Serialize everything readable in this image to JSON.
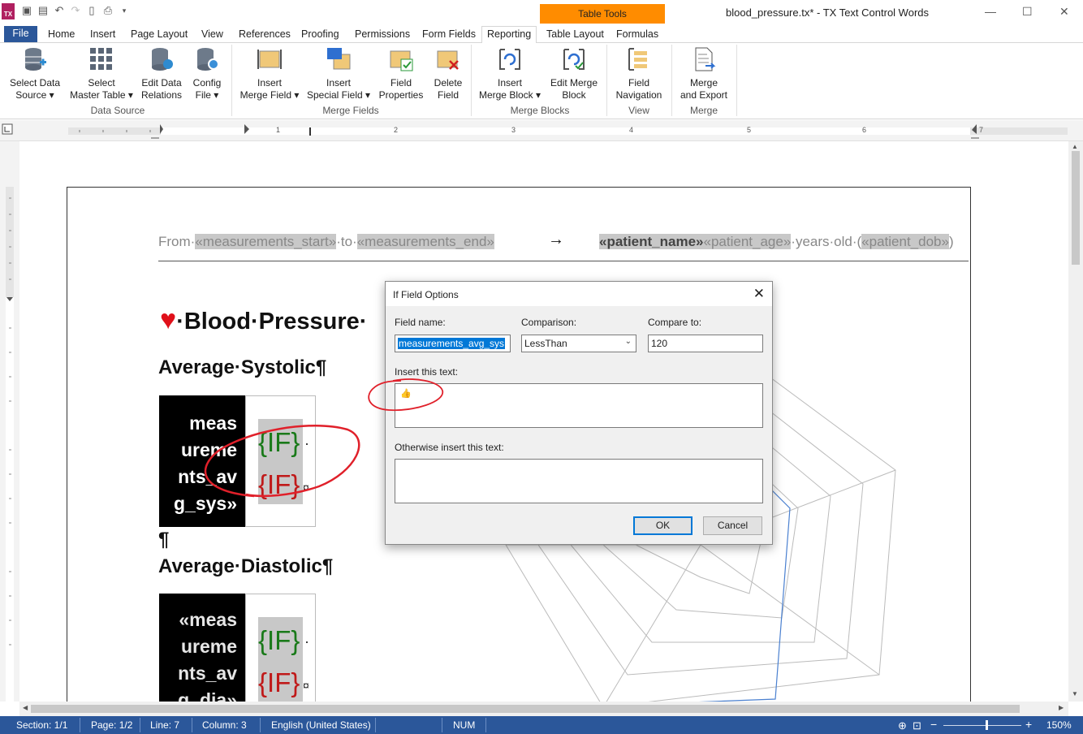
{
  "window": {
    "title": "blood_pressure.tx* - TX Text Control Words",
    "app_icon_label": "TX",
    "contextual_tab": "Table Tools"
  },
  "tabs": [
    "File",
    "Home",
    "Insert",
    "Page Layout",
    "View",
    "References",
    "Proofing",
    "Permissions",
    "Form Fields",
    "Reporting",
    "Table Layout",
    "Formulas"
  ],
  "ribbon": {
    "select_data_source": [
      "Select Data",
      "Source ▾"
    ],
    "select_master_table": [
      "Select",
      "Master Table ▾"
    ],
    "edit_data_relations": [
      "Edit Data",
      "Relations"
    ],
    "config_file": [
      "Config",
      "File ▾"
    ],
    "group_data_source": "Data Source",
    "insert_merge_field": [
      "Insert",
      "Merge Field ▾"
    ],
    "insert_special_field": [
      "Insert",
      "Special Field ▾"
    ],
    "field_properties": [
      "Field",
      "Properties"
    ],
    "delete_field": [
      "Delete",
      "Field"
    ],
    "group_merge_fields": "Merge Fields",
    "insert_merge_block": [
      "Insert",
      "Merge Block ▾"
    ],
    "edit_merge_block": [
      "Edit Merge",
      "Block"
    ],
    "group_merge_blocks": "Merge Blocks",
    "field_navigation": [
      "Field",
      "Navigation"
    ],
    "group_view": "View",
    "merge_and_export": [
      "Merge",
      "and Export"
    ],
    "group_merge": "Merge"
  },
  "ruler": {
    "numbers": [
      "1",
      "2",
      "3",
      "4",
      "5",
      "6",
      "7"
    ]
  },
  "document": {
    "header": {
      "from": "From·",
      "start_field": "«measurements_start»",
      "to": "·to·",
      "end_field": "«measurements_end»",
      "arrow": "→",
      "name_field": "«patient_name»",
      "age_field": "«patient_age»",
      "years_old": "·years·old·(",
      "dob_field": "«patient_dob»",
      "close": ")"
    },
    "title": "·Blood·Pressure·",
    "heart": "♥",
    "systolic_heading": "Average·Systolic¶",
    "systolic_field_lines": [
      "meas",
      "ureme",
      "nts_av",
      "g_sys»"
    ],
    "if_label": "{IF}",
    "dot": "·",
    "cell_end": "¤",
    "pilcrow": "¶",
    "diastolic_heading": "Average·Diastolic¶",
    "diastolic_field_lines": [
      "«meas",
      "ureme",
      "nts_av",
      "g_dia»"
    ]
  },
  "dialog": {
    "title": "If Field Options",
    "close_glyph": "✕",
    "field_name_label": "Field name:",
    "field_name_value": "measurements_avg_sys",
    "comparison_label": "Comparison:",
    "comparison_value": "LessThan",
    "compare_to_label": "Compare to:",
    "compare_to_value": "120",
    "insert_text_label": "Insert this text:",
    "insert_text_value": "👍",
    "otherwise_label": "Otherwise insert this text:",
    "otherwise_value": "",
    "ok": "OK",
    "cancel": "Cancel"
  },
  "status": {
    "section": "Section: 1/1",
    "page": "Page: 1/2",
    "line": "Line: 7",
    "column": "Column: 3",
    "language": "English (United States)",
    "num": "NUM",
    "zoom": "150%"
  },
  "colors": {
    "accent": "#2b579a",
    "contextual": "#ff8c00",
    "annotation": "#e0202a",
    "chart_line": "#4a80d0"
  }
}
